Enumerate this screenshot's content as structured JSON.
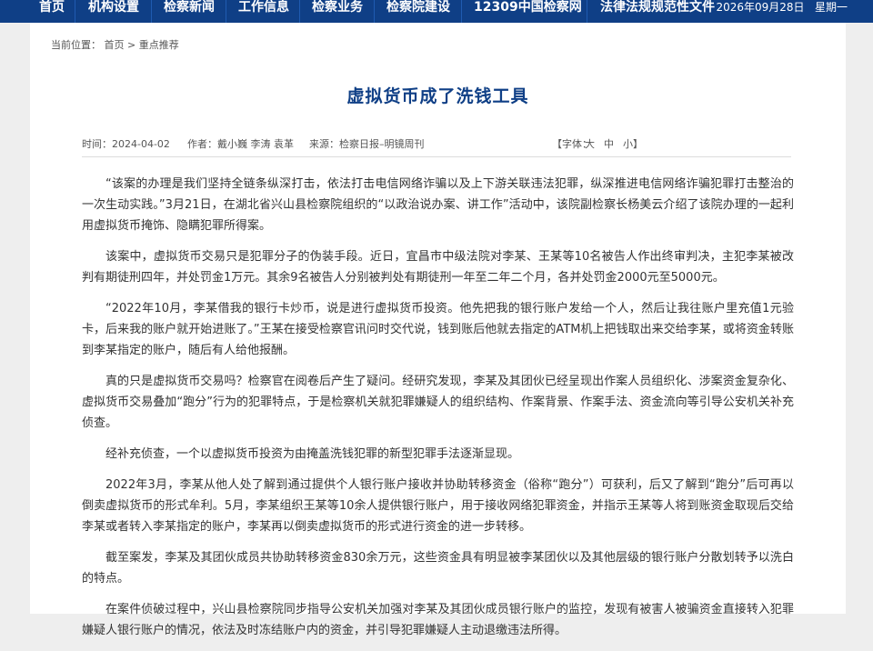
{
  "nav": {
    "items": [
      "首页",
      "机构设置",
      "检察新闻",
      "工作信息",
      "检察业务",
      "检察院建设",
      "12309中国检察网",
      "法律法规规范性文件"
    ],
    "date": "2026年09月28日",
    "weekday": "星期一"
  },
  "breadcrumb": {
    "prefix": "当前位置：",
    "home": "首页",
    "separator": ">",
    "current": "重点推荐"
  },
  "article": {
    "title": "虚拟货币成了洗钱工具",
    "time": "时间：2024-04-02",
    "author": "作者：戴小巍 李涛 袁革",
    "source": "来源：检察日报–明镜周刊",
    "font_size_label": "【字体：",
    "font_large": "大",
    "font_medium": "中",
    "font_small": "小】",
    "paragraphs": [
      "“该案的办理是我们坚持全链条纵深打击，依法打击电信网络诈骗以及上下游关联违法犯罪，纵深推进电信网络诈骗犯罪打击整治的一次生动实践。”3月21日，在湖北省兴山县检察院组织的“以政治说办案、讲工作”活动中，该院副检察长杨美云介绍了该院办理的一起利用虚拟货币掩饰、隐瞒犯罪所得案。",
      "该案中，虚拟货币交易只是犯罪分子的伪装手段。近日，宜昌市中级法院对李某、王某等10名被告人作出终审判决，主犯李某被改判有期徒刑四年，并处罚金1万元。其余9名被告人分别被判处有期徒刑一年至二年二个月，各并处罚金2000元至5000元。",
      "“2022年10月，李某借我的银行卡炒币，说是进行虚拟货币投资。他先把我的银行账户发给一个人，然后让我往账户里充值1元验卡，后来我的账户就开始进账了。”王某在接受检察官讯问时交代说，钱到账后他就去指定的ATM机上把钱取出来交给李某，或将资金转账到李某指定的账户，随后有人给他报酬。",
      "真的只是虚拟货币交易吗？检察官在阅卷后产生了疑问。经研究发现，李某及其团伙已经呈现出作案人员组织化、涉案资金复杂化、虚拟货币交易叠加“跑分”行为的犯罪特点，于是检察机关就犯罪嫌疑人的组织结构、作案背景、作案手法、资金流向等引导公安机关补充侦查。",
      "经补充侦查，一个以虚拟货币投资为由掩盖洗钱犯罪的新型犯罪手法逐渐显现。",
      "2022年3月，李某从他人处了解到通过提供个人银行账户接收并协助转移资金（俗称“跑分”）可获利，后又了解到“跑分”后可再以倒卖虚拟货币的形式牟利。5月，李某组织王某等10余人提供银行账户，用于接收网络犯罪资金，并指示王某等人将到账资金取现后交给李某或者转入李某指定的账户，李某再以倒卖虚拟货币的形式进行资金的进一步转移。",
      "截至案发，李某及其团伙成员共协助转移资金830余万元，这些资金具有明显被李某团伙以及其他层级的银行账户分散划转予以洗白的特点。",
      "在案件侦破过程中，兴山县检察院同步指导公安机关加强对李某及其团伙成员银行账户的监控，发现有被害人被骗资金直接转入犯罪嫌疑人银行账户的情况，依法及时冻结账户内的资金，并引导犯罪嫌疑人主动退缴违法所得。"
    ]
  }
}
